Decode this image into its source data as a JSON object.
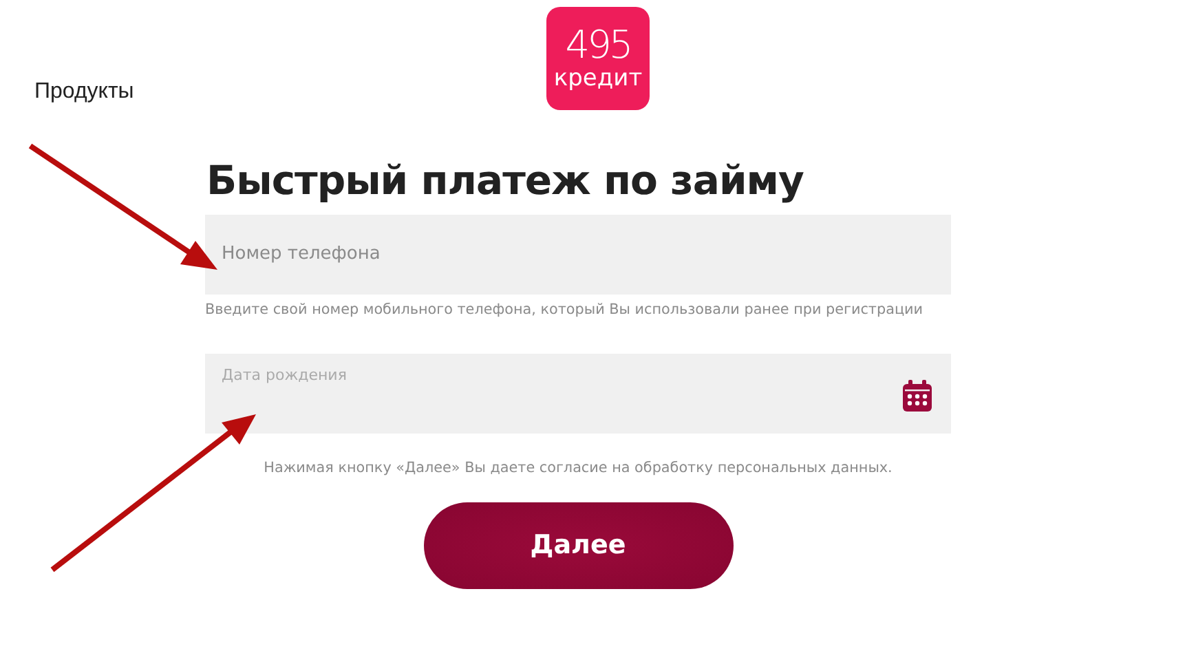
{
  "nav": {
    "label": "Продукты"
  },
  "logo": {
    "number": "495",
    "word": "кредит"
  },
  "title": "Быстрый платеж по займу",
  "fields": [
    {
      "kind": "phone",
      "placeholder": "Номер телефона",
      "hint": "Введите свой номер мобильного телефона, который Вы использовали ранее при регистрации"
    },
    {
      "kind": "date",
      "placeholder": "Дата рождения"
    }
  ],
  "consent": "Нажимая кнопку «Далее» Вы даете согласие на обработку персональных данных.",
  "button": "Далее"
}
